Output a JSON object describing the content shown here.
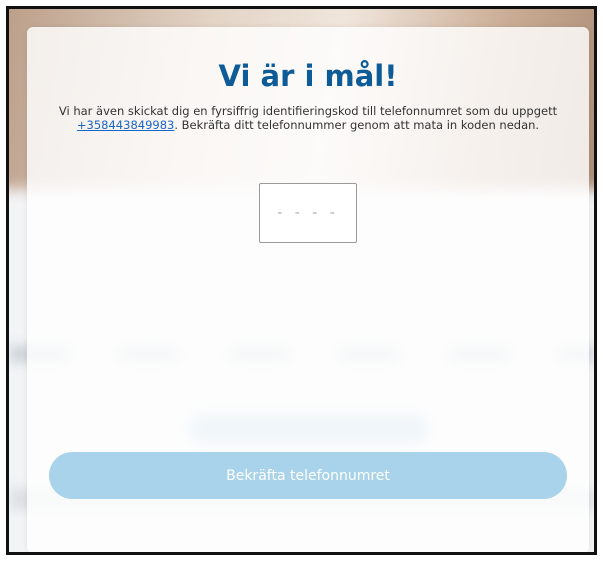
{
  "modal": {
    "title": "Vi är i mål!",
    "description_before": "Vi har även skickat dig en fyrsiffrig identifieringskod till telefonnumret som du uppgett ",
    "phone_number": "+358443849983",
    "description_after": ". Bekräfta ditt telefonnummer genom att mata in koden nedan.",
    "code_input": {
      "value": "",
      "placeholder": "- - - -"
    },
    "confirm_label": "Bekräfta telefonnumret"
  },
  "colors": {
    "title": "#0d5b97",
    "link": "#1a66c7",
    "button_bg": "#a8d3ea",
    "button_text": "#ffffff"
  }
}
